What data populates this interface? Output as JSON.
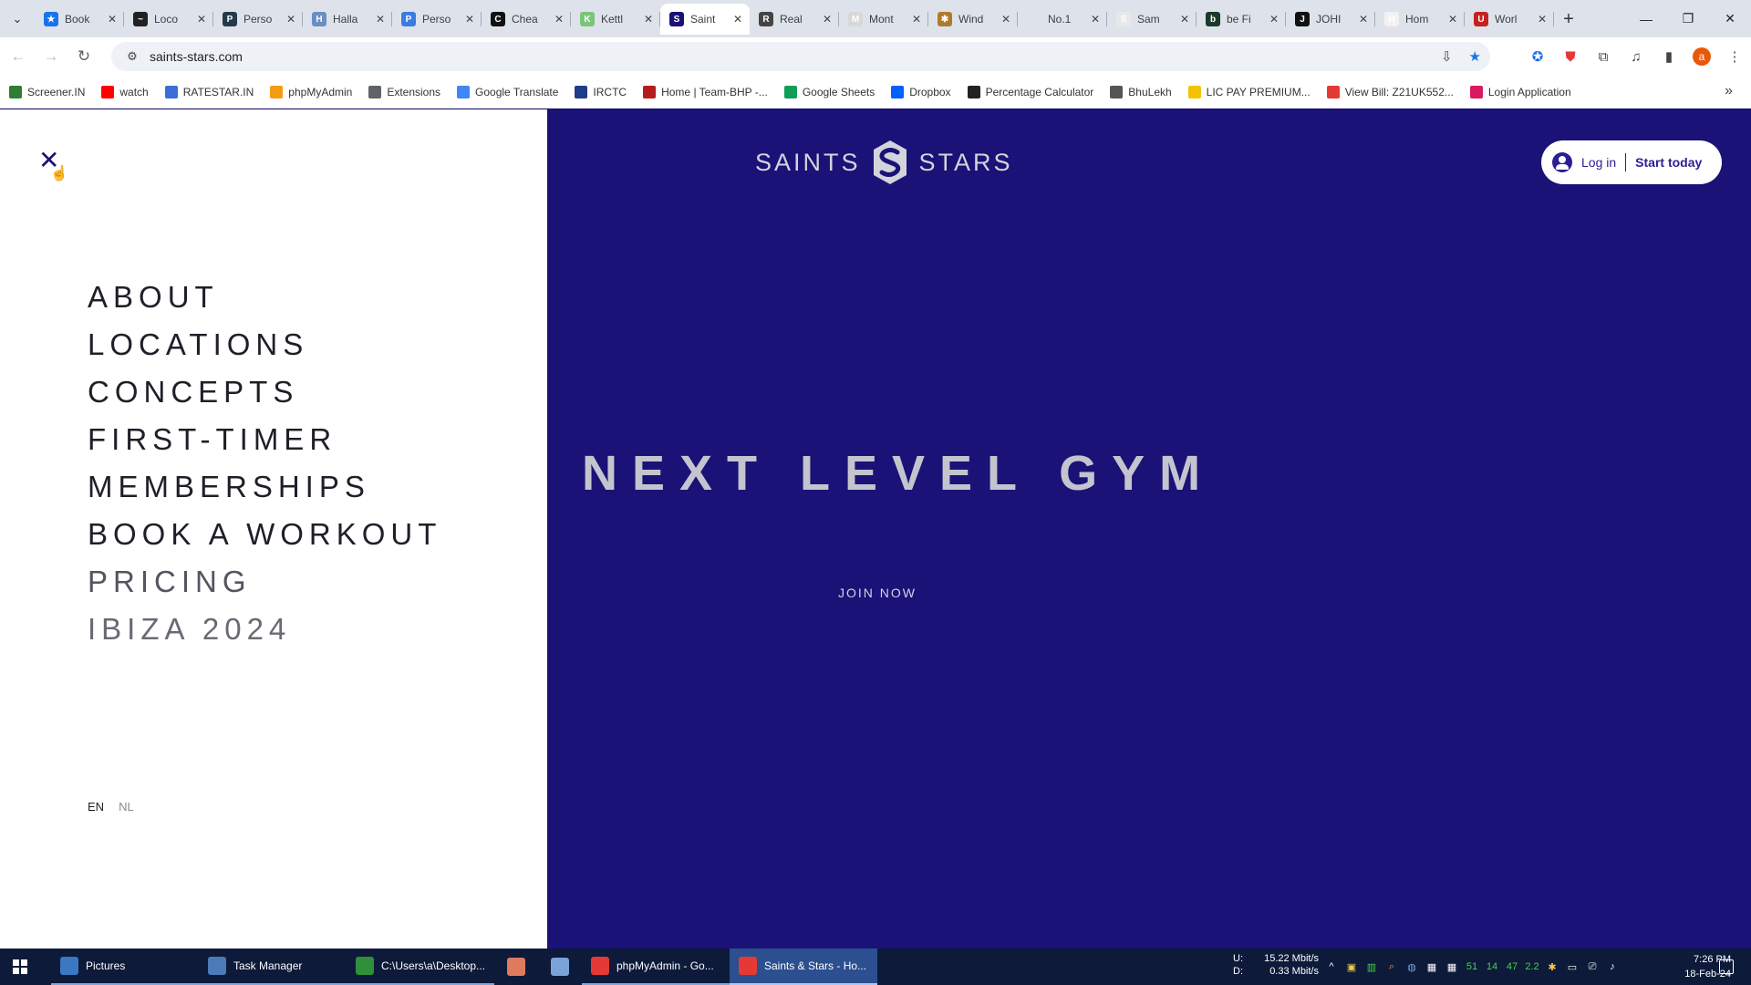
{
  "browser": {
    "tabs": [
      {
        "title": "Book",
        "color": "#1a73e8",
        "glyph": "★"
      },
      {
        "title": "Loco",
        "color": "#222222",
        "glyph": "~"
      },
      {
        "title": "Perso",
        "color": "#233a4a",
        "glyph": "P"
      },
      {
        "title": "Halla",
        "color": "#6b8fc4",
        "glyph": "H"
      },
      {
        "title": "Perso",
        "color": "#3d7be0",
        "glyph": "P"
      },
      {
        "title": "Chea",
        "color": "#111111",
        "glyph": "C"
      },
      {
        "title": "Kettl",
        "color": "#7cc47a",
        "glyph": "K"
      },
      {
        "title": "Saint",
        "color": "#1a1277",
        "glyph": "S"
      },
      {
        "title": "Real",
        "color": "#444444",
        "glyph": "R"
      },
      {
        "title": "Mont",
        "color": "#d8d8d8",
        "glyph": "M"
      },
      {
        "title": "Wind",
        "color": "#b07a2c",
        "glyph": "✱"
      },
      {
        "title": "No.1",
        "color": "#dee3eb",
        "glyph": ""
      },
      {
        "title": "Sam",
        "color": "#e8e8e8",
        "glyph": "S"
      },
      {
        "title": "be Fi",
        "color": "#1b3a2c",
        "glyph": "b"
      },
      {
        "title": "JOHI",
        "color": "#111111",
        "glyph": "J"
      },
      {
        "title": "Hom",
        "color": "#f2f2f2",
        "glyph": "H"
      },
      {
        "title": "Worl",
        "color": "#c5221f",
        "glyph": "U"
      }
    ],
    "active_tab_index": 7,
    "url": "saints-stars.com",
    "bookmarks": [
      {
        "label": "Screener.IN",
        "color": "#2e7d32"
      },
      {
        "label": "watch",
        "color": "#ff0000"
      },
      {
        "label": "RATESTAR.IN",
        "color": "#3a6fd8"
      },
      {
        "label": "phpMyAdmin",
        "color": "#f39c12"
      },
      {
        "label": "Extensions",
        "color": "#5f6368"
      },
      {
        "label": "Google Translate",
        "color": "#4285f4"
      },
      {
        "label": "IRCTC",
        "color": "#1f3c88"
      },
      {
        "label": "Home | Team-BHP -...",
        "color": "#b71c1c"
      },
      {
        "label": "Google Sheets",
        "color": "#0f9d58"
      },
      {
        "label": "Dropbox",
        "color": "#0061fe"
      },
      {
        "label": "Percentage Calculator",
        "color": "#222222"
      },
      {
        "label": "BhuLekh",
        "color": "#555555"
      },
      {
        "label": "LIC PAY PREMIUM...",
        "color": "#f6c200"
      },
      {
        "label": "View Bill: Z21UK552...",
        "color": "#e53935"
      },
      {
        "label": "Login Application",
        "color": "#d81b60"
      }
    ]
  },
  "page": {
    "menu": {
      "items": [
        "ABOUT",
        "LOCATIONS",
        "CONCEPTS",
        "FIRST-TIMER",
        "MEMBERSHIPS",
        "BOOK A WORKOUT",
        "PRICING",
        "IBIZA 2024"
      ],
      "languages": {
        "current": "EN",
        "other": "NL"
      }
    },
    "logo": {
      "left": "SAINTS",
      "right": "STARS"
    },
    "auth": {
      "login": "Log in",
      "start": "Start today"
    },
    "hero": {
      "title": "NEXT LEVEL GYM",
      "cta": "JOIN NOW"
    },
    "colors": {
      "brand": "#1a1277",
      "panel": "#ffffff"
    }
  },
  "taskbar": {
    "items": [
      {
        "label": "Pictures",
        "color": "#3a78c3"
      },
      {
        "label": "Task Manager",
        "color": "#4a7ab8"
      },
      {
        "label": "C:\\Users\\a\\Desktop...",
        "color": "#2f8f3a"
      },
      {
        "label": "",
        "color": "#e07a5f"
      },
      {
        "label": "",
        "color": "#7aa3d9"
      },
      {
        "label": "phpMyAdmin - Go...",
        "color": "#e53935"
      },
      {
        "label": "Saints & Stars - Ho...",
        "color": "#e53935"
      }
    ],
    "network": {
      "up_label": "U:",
      "up": "15.22 Mbit/s",
      "down_label": "D:",
      "down": "0.33 Mbit/s"
    },
    "tray": [
      "51",
      "14",
      "47",
      "2.2"
    ],
    "clock": {
      "time": "7:26 PM",
      "date": "18-Feb-24"
    }
  }
}
